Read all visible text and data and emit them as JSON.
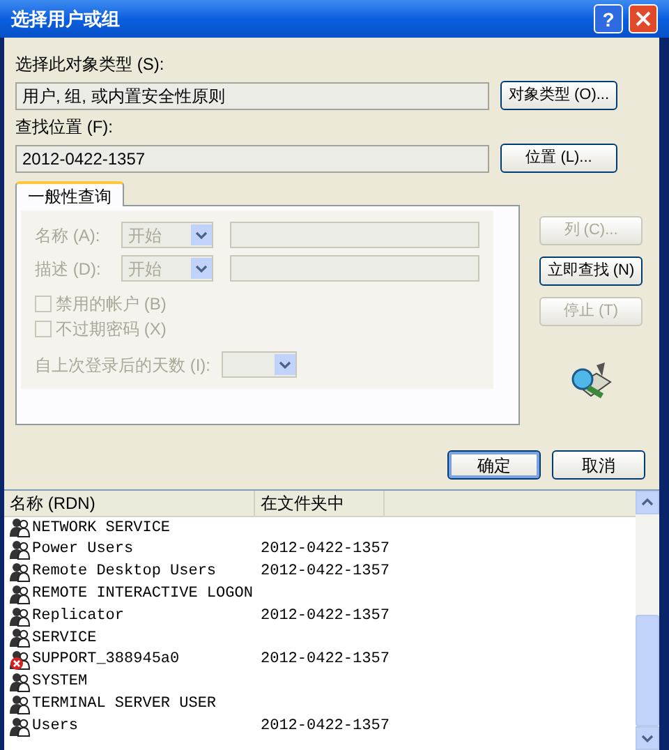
{
  "window": {
    "title": "选择用户或组",
    "help": "?"
  },
  "object_type": {
    "label": "选择此对象类型 (S):",
    "value": "用户, 组, 或内置安全性原则",
    "button": "对象类型 (O)..."
  },
  "location": {
    "label": "查找位置 (F):",
    "value": "2012-0422-1357",
    "button": "位置 (L)..."
  },
  "tabs": [
    {
      "label": "一般性查询",
      "selected": true
    }
  ],
  "query": {
    "disabled": true,
    "name": {
      "label": "名称 (A):",
      "mode": "开始"
    },
    "description": {
      "label": "描述 (D):",
      "mode": "开始"
    },
    "checkboxes": [
      {
        "label": "禁用的帐户 (B)",
        "checked": false
      },
      {
        "label": "不过期密码 (X)",
        "checked": false
      }
    ],
    "days": {
      "label": "自上次登录后的天数 (I):"
    }
  },
  "side_buttons": [
    {
      "label": "列 (C)...",
      "disabled": true
    },
    {
      "label": "立即查找 (N)",
      "disabled": false
    },
    {
      "label": "停止 (T)",
      "disabled": true
    }
  ],
  "dialog_buttons": [
    {
      "label": "确定",
      "default": true
    },
    {
      "label": "取消",
      "default": false
    }
  ],
  "results": {
    "columns": [
      "名称 (RDN)",
      "在文件夹中"
    ],
    "rows": [
      {
        "name": "NETWORK SERVICE",
        "folder": "",
        "kind": "group"
      },
      {
        "name": "Power Users",
        "folder": "2012-0422-1357",
        "kind": "group"
      },
      {
        "name": "Remote Desktop Users",
        "folder": "2012-0422-1357",
        "kind": "group"
      },
      {
        "name": "REMOTE INTERACTIVE LOGON",
        "folder": "",
        "kind": "group"
      },
      {
        "name": "Replicator",
        "folder": "2012-0422-1357",
        "kind": "group"
      },
      {
        "name": "SERVICE",
        "folder": "",
        "kind": "group"
      },
      {
        "name": "SUPPORT_388945a0",
        "folder": "2012-0422-1357",
        "kind": "disabled"
      },
      {
        "name": "SYSTEM",
        "folder": "",
        "kind": "group"
      },
      {
        "name": "TERMINAL SERVER USER",
        "folder": "",
        "kind": "group"
      },
      {
        "name": "Users",
        "folder": "2012-0422-1357",
        "kind": "group"
      }
    ]
  }
}
